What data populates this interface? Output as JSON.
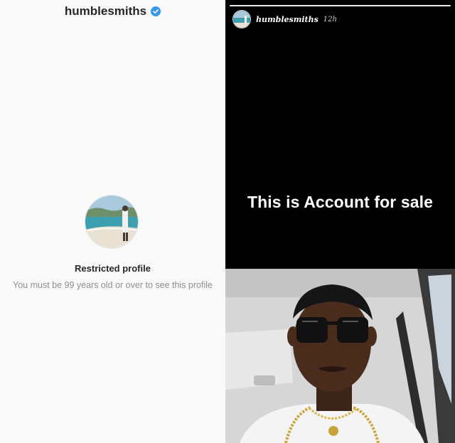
{
  "profile": {
    "username": "humblesmiths",
    "restricted_title": "Restricted profile",
    "restricted_desc": "You must be 99 years old or over to see this profile"
  },
  "story": {
    "username": "humblesmiths",
    "time": "12h",
    "caption": "This is Account for sale"
  },
  "colors": {
    "verified": "#3897f0",
    "story_bg": "#000000",
    "panel_bg": "#fafafa"
  },
  "icons": {
    "verified": "verified-badge-icon"
  }
}
